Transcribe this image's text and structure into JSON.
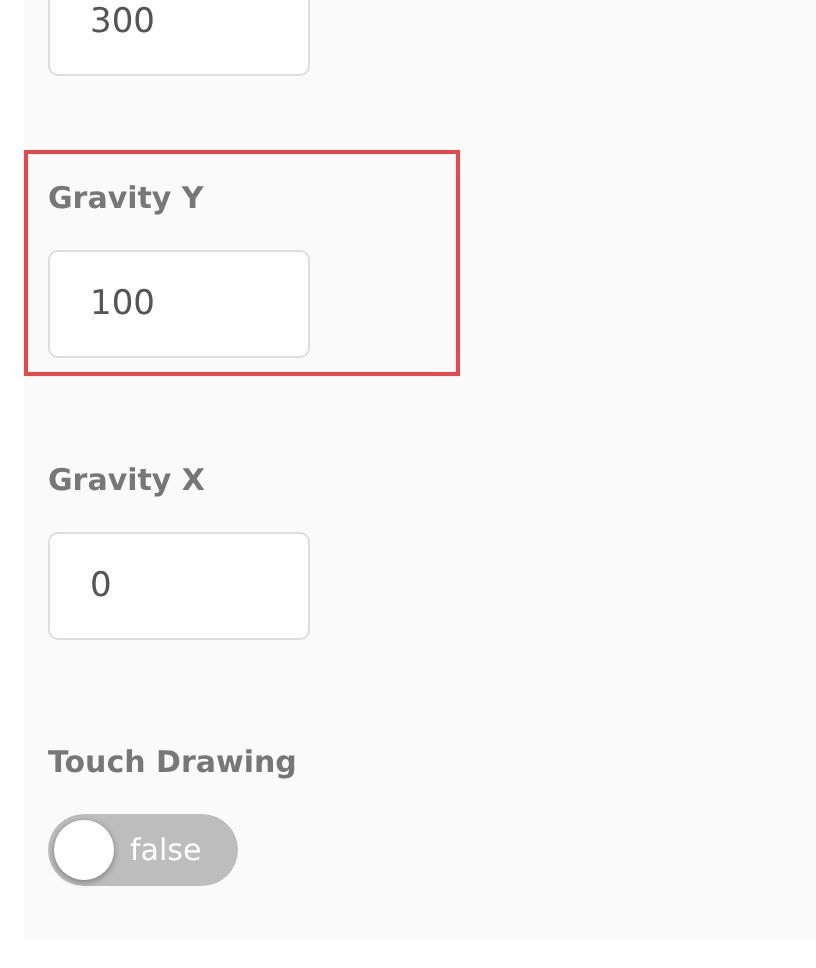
{
  "fields": [
    {
      "value": "300",
      "highlighted": false
    },
    {
      "label": "Gravity Y",
      "value": "100",
      "highlighted": true
    },
    {
      "label": "Gravity X",
      "value": "0",
      "highlighted": false
    }
  ],
  "toggle": {
    "label": "Touch Drawing",
    "on": false,
    "text": "false"
  }
}
